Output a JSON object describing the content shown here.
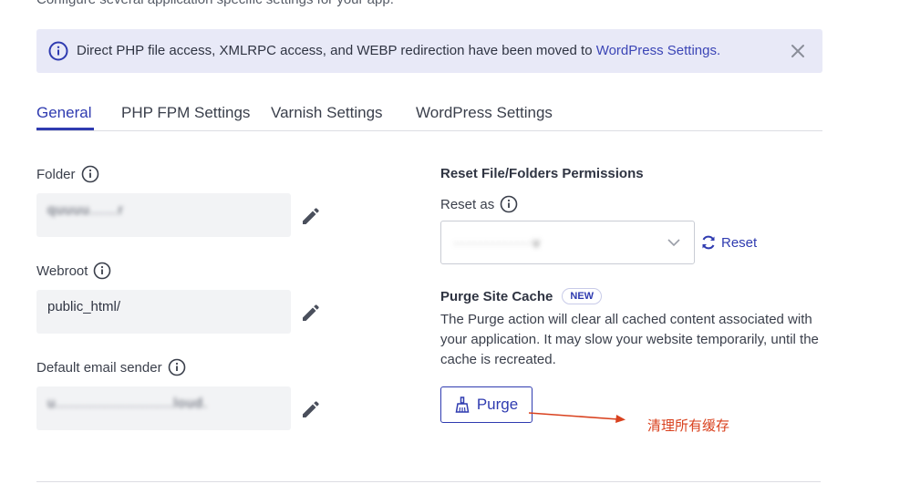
{
  "header": {
    "subtitle": "Configure several application specific settings for your app."
  },
  "notice": {
    "message": "Direct PHP file access, XMLRPC access, and WEBP redirection have been moved to ",
    "link_text": "WordPress Settings."
  },
  "tabs": [
    {
      "label": "General",
      "active": true
    },
    {
      "label": "PHP FPM Settings",
      "active": false
    },
    {
      "label": "Varnish Settings",
      "active": false
    },
    {
      "label": "WordPress Settings",
      "active": false
    }
  ],
  "left": {
    "folder": {
      "label": "Folder",
      "value": "quuuu......r"
    },
    "webroot": {
      "label": "Webroot",
      "value": "public_html/"
    },
    "email": {
      "label": "Default email sender",
      "value": "u.........................loud."
    }
  },
  "right": {
    "permissions": {
      "title": "Reset File/Folders Permissions",
      "reset_as_label": "Reset as",
      "reset_as_value": "·············v",
      "reset_button": "Reset"
    },
    "purge": {
      "title": "Purge Site Cache",
      "badge": "NEW",
      "description": "The Purge action will clear all cached content associated with your application. It may slow your website temporarily, until the cache is recreated.",
      "button": "Purge"
    }
  },
  "annotation": {
    "text": "清理所有缓存",
    "color": "#d9411e"
  },
  "colors": {
    "accent": "#2f3bb0",
    "notice_bg": "#e8e9f7",
    "field_bg": "#f2f3f5"
  },
  "icons": [
    "info-icon",
    "close-icon",
    "question-icon",
    "pencil-icon",
    "chevron-down-icon",
    "refresh-icon",
    "broom-icon"
  ]
}
